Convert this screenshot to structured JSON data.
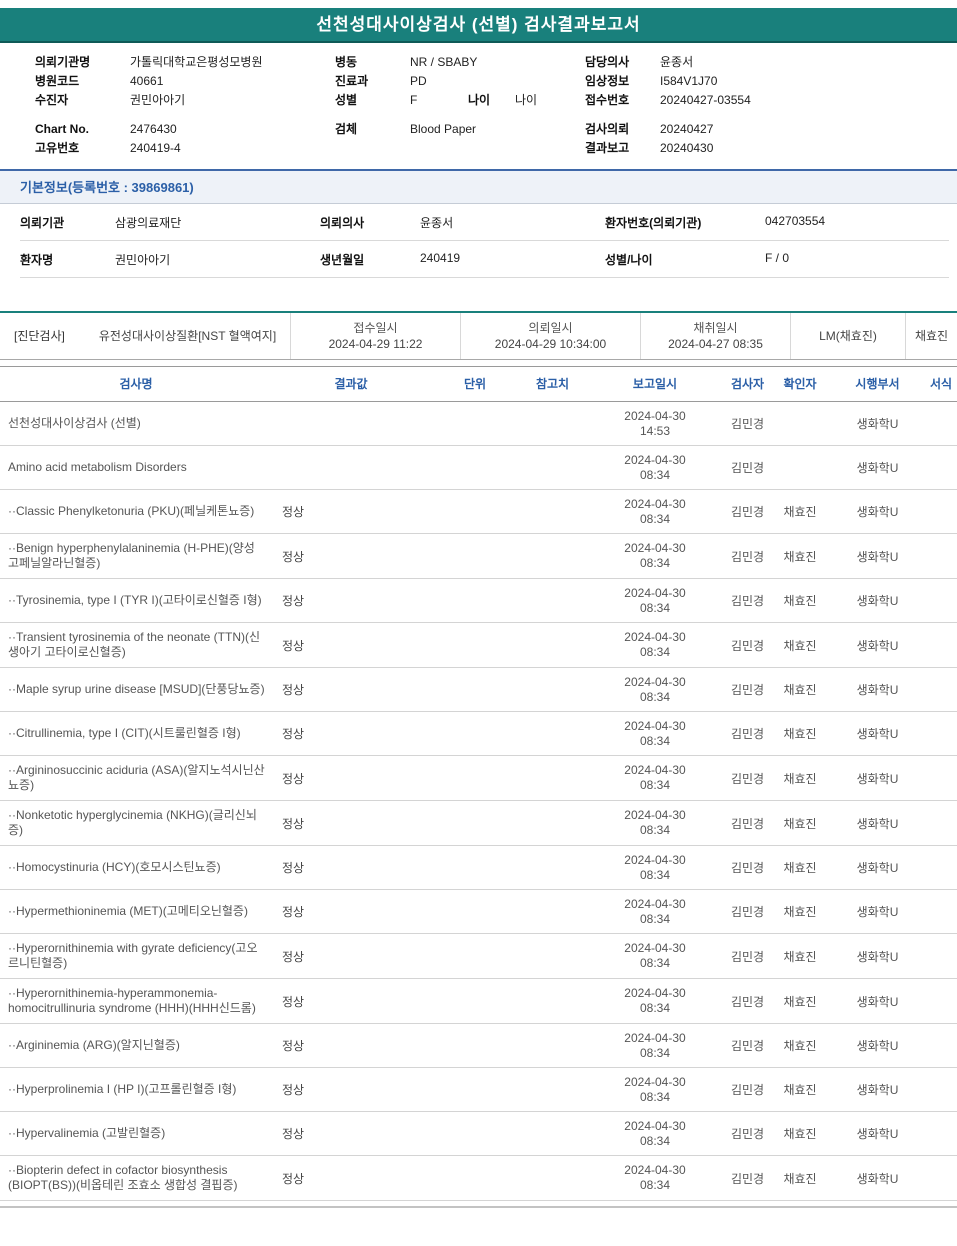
{
  "title": "선천성대사이상검사 (선별) 검사결과보고서",
  "colors": {
    "banner_teal": "#19807c",
    "accent_blue": "#2b5fa7"
  },
  "header": {
    "left": [
      {
        "label": "의뢰기관명",
        "value": "가톨릭대학교은평성모병원"
      },
      {
        "label": "병원코드",
        "value": "40661"
      },
      {
        "label": "수진자",
        "value": "권민아아기"
      },
      {
        "label": "Chart No.",
        "value": "2476430"
      },
      {
        "label": "고유번호",
        "value": "240419-4"
      }
    ],
    "middle": [
      {
        "label": "병동",
        "value": "NR / SBABY"
      },
      {
        "label": "진료과",
        "value": "PD"
      },
      {
        "label": "성별",
        "value": "F",
        "label2": "나이",
        "value2": "나이"
      },
      {
        "label": "검체",
        "value": "Blood Paper"
      }
    ],
    "right": [
      {
        "label": "담당의사",
        "value": "윤종서"
      },
      {
        "label": "임상정보",
        "value": "I584V1J70"
      },
      {
        "label": "접수번호",
        "value": "20240427-03554"
      },
      {
        "label": "검사의뢰",
        "value": "20240427"
      },
      {
        "label": "결과보고",
        "value": "20240430"
      }
    ]
  },
  "basic_info": {
    "title": "기본정보(등록번호 : 39869861)",
    "rows": [
      [
        {
          "label": "의뢰기관",
          "value": "삼광의료재단"
        },
        {
          "label": "의뢰의사",
          "value": "윤종서"
        },
        {
          "label": "환자번호(의뢰기관)",
          "value": "042703554"
        }
      ],
      [
        {
          "label": "환자명",
          "value": "권민아아기"
        },
        {
          "label": "생년월일",
          "value": "240419"
        },
        {
          "label": "성별/나이",
          "value": "F / 0"
        }
      ]
    ]
  },
  "order_band": {
    "tag": "[진단검사]",
    "test_group": "유전성대사이상질환[NST 혈액여지]",
    "columns": [
      {
        "label": "접수일시",
        "value": "2024-04-29 11:22"
      },
      {
        "label": "의뢰일시",
        "value": "2024-04-29 10:34:00"
      },
      {
        "label": "채취일시",
        "value": "2024-04-27 08:35"
      }
    ],
    "collector": "LM(채효진)",
    "collector_team": "채효진"
  },
  "results": {
    "headers": [
      "검사명",
      "결과값",
      "단위",
      "참고치",
      "보고일시",
      "검사자",
      "확인자",
      "시행부서",
      "서식"
    ],
    "rows": [
      {
        "name": "선천성대사이상검사 (선별)",
        "result": "",
        "unit": "",
        "ref": "",
        "reported": "2024-04-30\n14:53",
        "tester": "김민경",
        "verifier": "",
        "dept": "생화학U"
      },
      {
        "name": "Amino acid metabolism Disorders",
        "result": "",
        "unit": "",
        "ref": "",
        "reported": "2024-04-30\n08:34",
        "tester": "김민경",
        "verifier": "",
        "dept": "생화학U"
      },
      {
        "name": "··Classic Phenylketonuria (PKU)(페닐케톤뇨증)",
        "result": "정상",
        "unit": "",
        "ref": "",
        "reported": "2024-04-30\n08:34",
        "tester": "김민경",
        "verifier": "채효진",
        "dept": "생화학U"
      },
      {
        "name": "··Benign hyperphenylalaninemia (H-PHE)(양성 고페닐알라닌혈증)",
        "result": "정상",
        "unit": "",
        "ref": "",
        "reported": "2024-04-30\n08:34",
        "tester": "김민경",
        "verifier": "채효진",
        "dept": "생화학U"
      },
      {
        "name": "··Tyrosinemia, type I (TYR I)(고타이로신혈증 I형)",
        "result": "정상",
        "unit": "",
        "ref": "",
        "reported": "2024-04-30\n08:34",
        "tester": "김민경",
        "verifier": "채효진",
        "dept": "생화학U"
      },
      {
        "name": "··Transient tyrosinemia of the neonate (TTN)(신생아기 고타이로신혈증)",
        "result": "정상",
        "unit": "",
        "ref": "",
        "reported": "2024-04-30\n08:34",
        "tester": "김민경",
        "verifier": "채효진",
        "dept": "생화학U"
      },
      {
        "name": "··Maple syrup urine disease [MSUD](단풍당뇨증)",
        "result": "정상",
        "unit": "",
        "ref": "",
        "reported": "2024-04-30\n08:34",
        "tester": "김민경",
        "verifier": "채효진",
        "dept": "생화학U"
      },
      {
        "name": "··Citrullinemia, type I (CIT)(시트룰린혈증 I형)",
        "result": "정상",
        "unit": "",
        "ref": "",
        "reported": "2024-04-30\n08:34",
        "tester": "김민경",
        "verifier": "채효진",
        "dept": "생화학U"
      },
      {
        "name": "··Argininosuccinic aciduria (ASA)(알지노석시닌산뇨증)",
        "result": "정상",
        "unit": "",
        "ref": "",
        "reported": "2024-04-30\n08:34",
        "tester": "김민경",
        "verifier": "채효진",
        "dept": "생화학U"
      },
      {
        "name": "··Nonketotic hyperglycinemia (NKHG)(글리신뇌증)",
        "result": "정상",
        "unit": "",
        "ref": "",
        "reported": "2024-04-30\n08:34",
        "tester": "김민경",
        "verifier": "채효진",
        "dept": "생화학U"
      },
      {
        "name": "··Homocystinuria (HCY)(호모시스틴뇨증)",
        "result": "정상",
        "unit": "",
        "ref": "",
        "reported": "2024-04-30\n08:34",
        "tester": "김민경",
        "verifier": "채효진",
        "dept": "생화학U"
      },
      {
        "name": "··Hypermethioninemia (MET)(고메티오닌혈증)",
        "result": "정상",
        "unit": "",
        "ref": "",
        "reported": "2024-04-30\n08:34",
        "tester": "김민경",
        "verifier": "채효진",
        "dept": "생화학U"
      },
      {
        "name": "··Hyperornithinemia with gyrate deficiency(고오르니틴혈증)",
        "result": "정상",
        "unit": "",
        "ref": "",
        "reported": "2024-04-30\n08:34",
        "tester": "김민경",
        "verifier": "채효진",
        "dept": "생화학U"
      },
      {
        "name": "··Hyperornithinemia-hyperammonemia-homocitrullinuria syndrome (HHH)(HHH신드롬)",
        "result": "정상",
        "unit": "",
        "ref": "",
        "reported": "2024-04-30\n08:34",
        "tester": "김민경",
        "verifier": "채효진",
        "dept": "생화학U"
      },
      {
        "name": "··Argininemia (ARG)(알지닌혈증)",
        "result": "정상",
        "unit": "",
        "ref": "",
        "reported": "2024-04-30\n08:34",
        "tester": "김민경",
        "verifier": "채효진",
        "dept": "생화학U"
      },
      {
        "name": "··Hyperprolinemia I (HP I)(고프롤린혈증 I형)",
        "result": "정상",
        "unit": "",
        "ref": "",
        "reported": "2024-04-30\n08:34",
        "tester": "김민경",
        "verifier": "채효진",
        "dept": "생화학U"
      },
      {
        "name": "··Hypervalinemia (고발린혈증)",
        "result": "정상",
        "unit": "",
        "ref": "",
        "reported": "2024-04-30\n08:34",
        "tester": "김민경",
        "verifier": "채효진",
        "dept": "생화학U"
      },
      {
        "name": "··Biopterin defect in cofactor biosynthesis (BIOPT(BS))(비옵테린 조효소 생합성 결핍증)",
        "result": "정상",
        "unit": "",
        "ref": "",
        "reported": "2024-04-30\n08:34",
        "tester": "김민경",
        "verifier": "채효진",
        "dept": "생화학U"
      }
    ]
  }
}
